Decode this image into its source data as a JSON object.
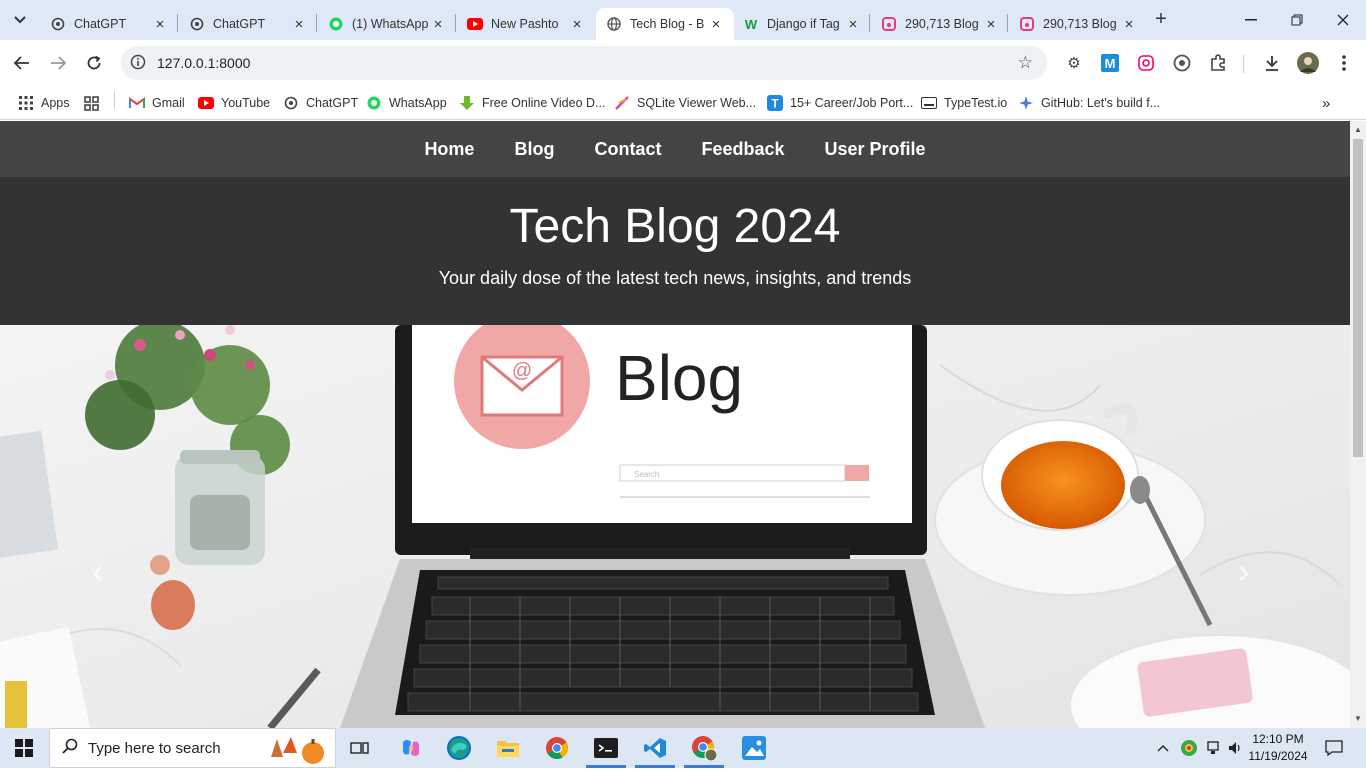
{
  "browser": {
    "tabs": [
      {
        "label": "ChatGPT",
        "icon": "chatgpt-icon"
      },
      {
        "label": "ChatGPT",
        "icon": "chatgpt-icon"
      },
      {
        "label": "(1) WhatsApp",
        "icon": "whatsapp-icon"
      },
      {
        "label": "New Pashto",
        "icon": "youtube-icon"
      },
      {
        "label": "Tech Blog - B",
        "icon": "globe-icon",
        "active": true
      },
      {
        "label": "Django if Tag",
        "icon": "w-icon"
      },
      {
        "label": "290,713 Blog",
        "icon": "freepik-icon"
      },
      {
        "label": "290,713 Blog",
        "icon": "freepik-icon"
      }
    ],
    "url": "127.0.0.1:8000",
    "bookmarks": [
      {
        "label": "Apps"
      },
      {
        "label": "Gmail"
      },
      {
        "label": "YouTube"
      },
      {
        "label": "ChatGPT"
      },
      {
        "label": "WhatsApp"
      },
      {
        "label": "Free Online Video D..."
      },
      {
        "label": "SQLite Viewer Web..."
      },
      {
        "label": "15+ Career/Job Port..."
      },
      {
        "label": "TypeTest.io"
      },
      {
        "label": "GitHub: Let's build f..."
      }
    ]
  },
  "site": {
    "nav": [
      "Home",
      "Blog",
      "Contact",
      "Feedback",
      "User Profile"
    ],
    "title": "Tech Blog 2024",
    "subtitle": "Your daily dose of the latest tech news, insights, and trends",
    "carousel": {
      "screen_text": "Blog",
      "search_placeholder": "Search"
    }
  },
  "taskbar": {
    "search_placeholder": "Type here to search",
    "time": "12:10 PM",
    "date": "11/19/2024"
  },
  "colors": {
    "site_nav": "#444444",
    "site_hero": "#333333",
    "tabstrip": "#dee8f6",
    "taskbar": "#dde6f3"
  }
}
